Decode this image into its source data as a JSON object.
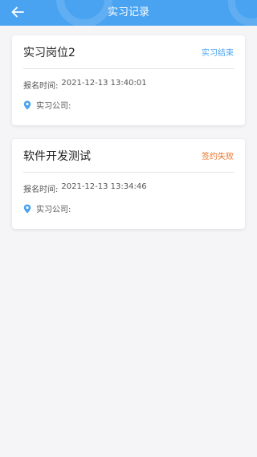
{
  "header": {
    "title": "实习记录",
    "back_icon": "arrow-left-icon",
    "background_color": "#4aa3f0"
  },
  "records": [
    {
      "title": "实习岗位2",
      "status": "实习结束",
      "status_color": "#4aa3f0",
      "time_label": "报名时间:",
      "time_value": "2021-12-13 13:40:01",
      "company_label": "实习公司:",
      "company_value": ""
    },
    {
      "title": "软件开发测试",
      "status": "签约失败",
      "status_color": "#e8742a",
      "time_label": "报名时间:",
      "time_value": "2021-12-13 13:34:46",
      "company_label": "实习公司:",
      "company_value": ""
    }
  ]
}
